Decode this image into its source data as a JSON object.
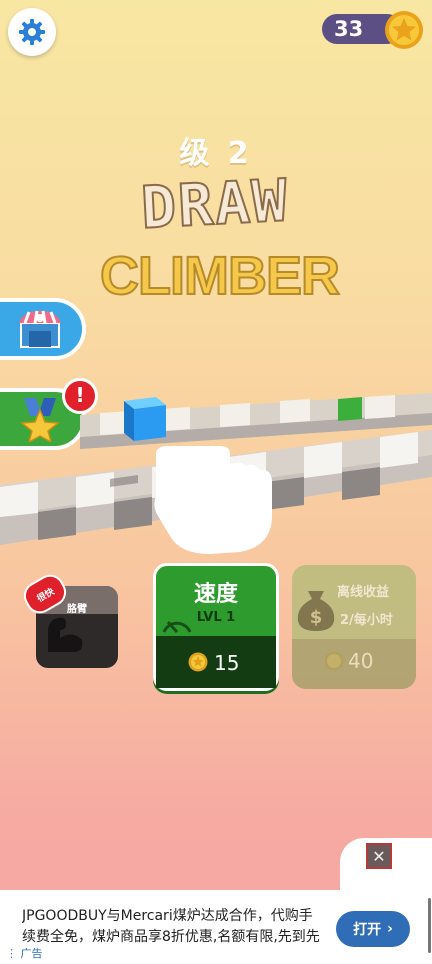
{
  "topbar": {
    "coins": "33"
  },
  "title": {
    "level": "级 2",
    "logo_line1": "DRAW",
    "logo_line2": "CLIMBER"
  },
  "side": {
    "alert": "!"
  },
  "upgrades": {
    "arm": {
      "badge": "很快",
      "label": "胳臂"
    },
    "speed": {
      "title": "速度",
      "level": "LVL 1",
      "cost": "15"
    },
    "offline": {
      "title": "离线收益",
      "rate": "2/每小时",
      "cost": "40"
    }
  },
  "ad": {
    "text": "JPGOODBUY与Mercari煤炉达成合作，代购手续费全免，煤炉商品享8折优惠,名额有限,先到先得!",
    "button": "打开",
    "label": "广告"
  },
  "colors": {
    "accent_green": "#2e9b2e",
    "coin_pill": "#5b4f84",
    "ad_button": "#2f6db6"
  }
}
